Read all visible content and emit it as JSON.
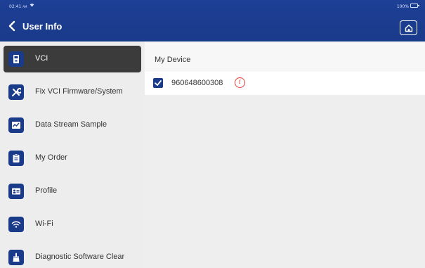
{
  "status_bar": {
    "time": "02:41",
    "ampm": "AM",
    "battery": "100%"
  },
  "header": {
    "title": "User Info"
  },
  "sidebar": {
    "items": [
      {
        "label": "VCI",
        "icon": "vci-icon",
        "active": true
      },
      {
        "label": "Fix VCI Firmware/System",
        "icon": "wrench-icon",
        "active": false
      },
      {
        "label": "Data Stream Sample",
        "icon": "data-stream-icon",
        "active": false
      },
      {
        "label": "My Order",
        "icon": "clipboard-icon",
        "active": false
      },
      {
        "label": "Profile",
        "icon": "profile-card-icon",
        "active": false
      },
      {
        "label": "Wi-Fi",
        "icon": "wifi-icon",
        "active": false
      },
      {
        "label": "Diagnostic Software Clear",
        "icon": "brush-icon",
        "active": false
      }
    ]
  },
  "main": {
    "section_title": "My Device",
    "devices": [
      {
        "serial": "960648600308",
        "checked": true
      }
    ]
  },
  "colors": {
    "header_bg": "#1a3a8a",
    "sidebar_bg": "#ededed",
    "active_item_bg": "#3b3b3b",
    "icon_bg": "#1a3a8a",
    "info_red": "#e53935"
  }
}
